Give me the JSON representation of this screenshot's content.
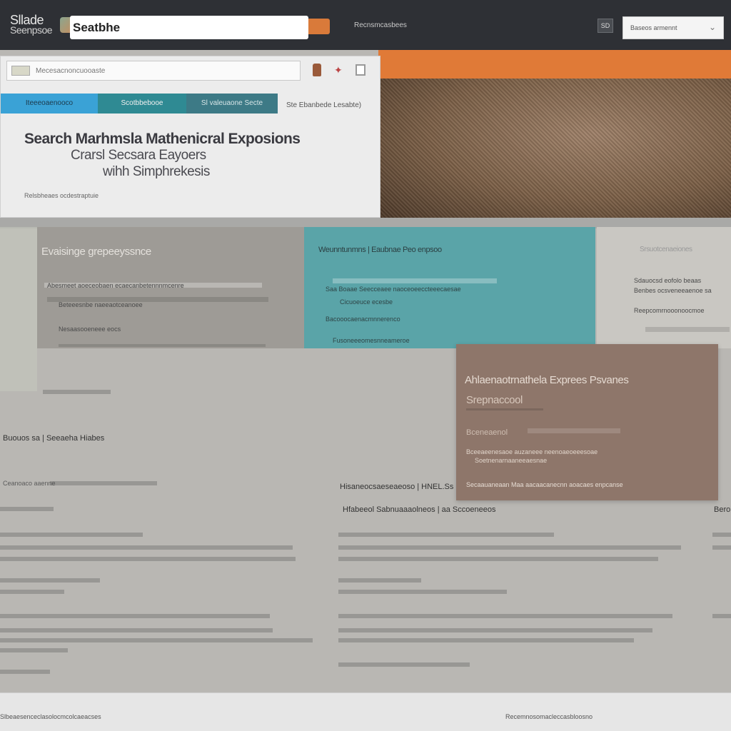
{
  "header": {
    "logo_line1": "Sllade",
    "logo_line2": "Seenpsoe",
    "search_value": "Seatbhe",
    "top_link": "Recnsmcasbees",
    "square_btn": "SD",
    "account_text": "Baseos armennt",
    "account_caret": "⌄"
  },
  "browser": {
    "address": "Mecesacnoncuooaste",
    "tabs": [
      "Iteeeoaenooco",
      "Scotbbebooe",
      "Sl valeuaone Secte"
    ],
    "tab_side_label": "Ste Ebanbede Lesabte)"
  },
  "hero": {
    "line1": "Search Marhmsla Mathenicral Exposions",
    "line2": "Crarsl Secsara Eayoers",
    "line3": "wihh Simphrekesis",
    "small": "Relsbheaes ocdestraptuie"
  },
  "cards": {
    "gray_title": "Evaisinge grepeeyssnce",
    "gray_lines": [
      "Abesmeet aoeceobaen ecaecanbetennnmcenre",
      "Beteeesnbe naeeaotceanoee",
      "Nesaasooeneee eocs"
    ],
    "teal_title": "Weunntunmns | Eaubnae Peo enpsoo",
    "teal_lines": [
      "Saa Boaae Seecceaee naoceoeeccteeecaesae",
      "Cicuoeuce ecesbe",
      "Bacooocaenacmnnerenco",
      "Fusoneeeomesnneameroe"
    ],
    "right_title": "Srsuotcenaeiones",
    "right_lines": [
      "Sdauocsd eofolo beaas",
      "Benbes ocsveneeaenoe sa",
      "Reepcomrnooonoocmoe"
    ],
    "brown_title": "Ahlaenaotrnathela Exprees Psvanes",
    "brown_sub": "Srepnaccool",
    "brown_sub2": "Bceneaenol",
    "brown_lines": [
      "Bceeaeenesaoe auzaneee neenoaeoeeesoae",
      "Soetnenarnaaneeaesnae"
    ],
    "brown_footer": "Secaauaneaan Maa aacaacanecnn aoacaes enpcanse"
  },
  "lower": {
    "left_label": "Buouos sa | Seeaeha Hiabes",
    "left_small": "Ceanoaco aaenne",
    "mid_heading": "Hisaneocsaeseaeoso | HNEL.Ss",
    "mid_heading2": "Hfabeeol Sabnuaaaolneos | aa Sccoeneeos",
    "right_edge": "Bero",
    "footer_left": "Slbeaesenceclasolocmcolcaeacses",
    "footer_right": "Recemnosomacleccasbloosno"
  }
}
